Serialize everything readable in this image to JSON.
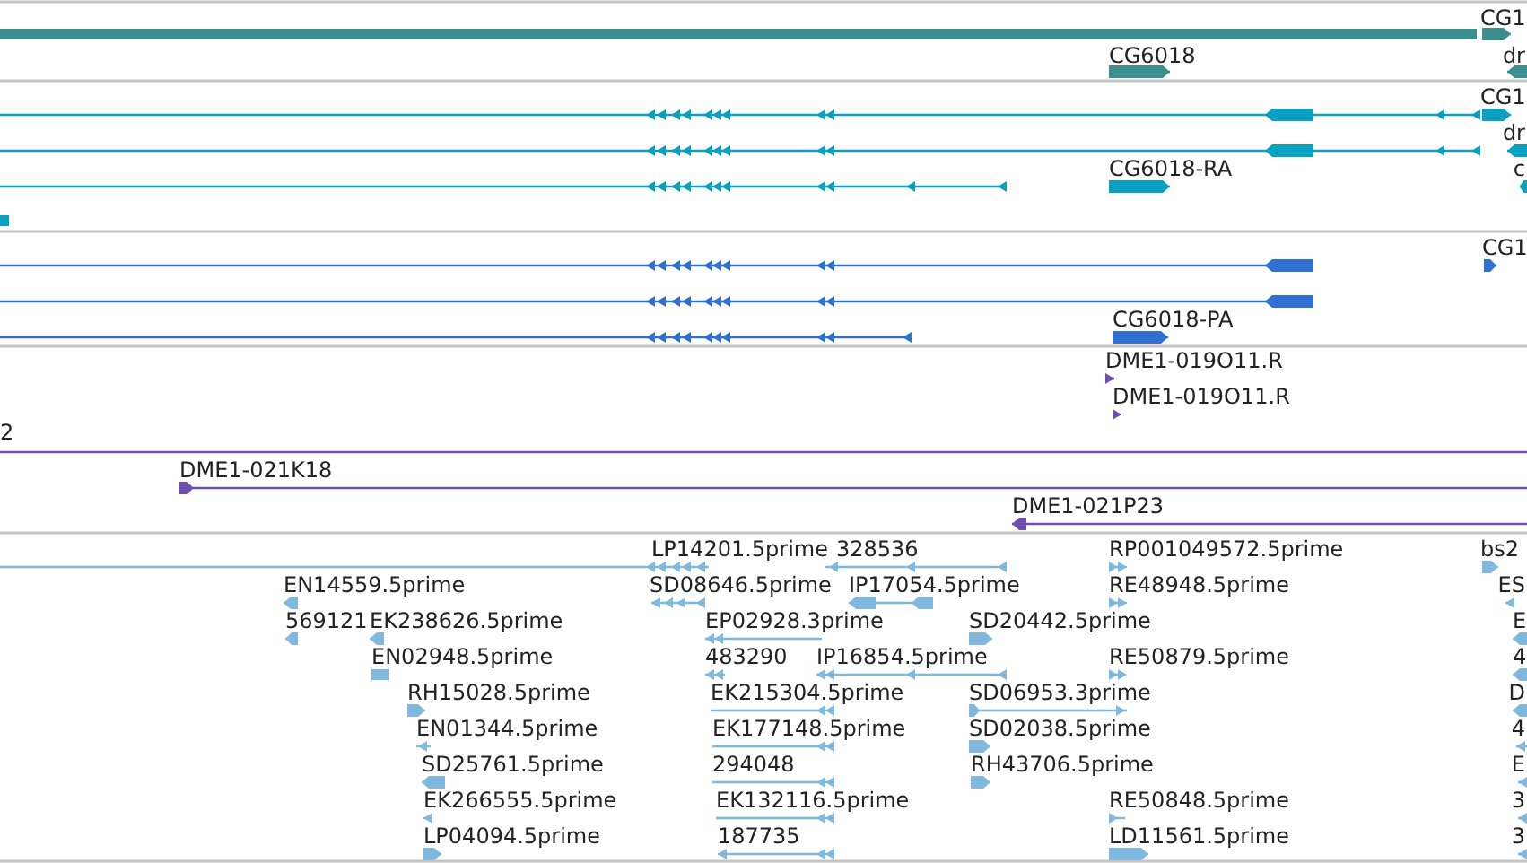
{
  "tracks": [
    {
      "color": "#3d8f8f",
      "features": [
        {
          "label": "CG1"
        },
        {
          "label": "CG6018"
        },
        {
          "label": "dr"
        }
      ]
    },
    {
      "color": "#0aa0c0",
      "features": [
        {
          "label": "CG1"
        },
        {
          "label": "dr"
        },
        {
          "label": "CG6018-RA"
        },
        {
          "label": "c"
        }
      ]
    },
    {
      "color": "#3070d0",
      "features": [
        {
          "label": "CG1"
        },
        {
          "label": "CG6018-PA"
        }
      ]
    },
    {
      "color": "#6e4fae",
      "features": [
        {
          "label": "DME1-019O11.R"
        },
        {
          "label": "DME1-019O11.R"
        },
        {
          "label": "2"
        },
        {
          "label": "DME1-021K18"
        },
        {
          "label": "DME1-021P23"
        }
      ]
    },
    {
      "color": "#80b8e0",
      "features": [
        {
          "label": "LP14201.5prime"
        },
        {
          "label": "328536"
        },
        {
          "label": "RP001049572.5prime"
        },
        {
          "label": "bs2"
        },
        {
          "label": "EN14559.5prime"
        },
        {
          "label": "SD08646.5prime"
        },
        {
          "label": "IP17054.5prime"
        },
        {
          "label": "RE48948.5prime"
        },
        {
          "label": "ES"
        },
        {
          "label": "569121"
        },
        {
          "label": "EK238626.5prime"
        },
        {
          "label": "EP02928.3prime"
        },
        {
          "label": "SD20442.5prime"
        },
        {
          "label": "E"
        },
        {
          "label": "EN02948.5prime"
        },
        {
          "label": "483290"
        },
        {
          "label": "IP16854.5prime"
        },
        {
          "label": "RE50879.5prime"
        },
        {
          "label": "4"
        },
        {
          "label": "RH15028.5prime"
        },
        {
          "label": "EK215304.5prime"
        },
        {
          "label": "SD06953.3prime"
        },
        {
          "label": "D"
        },
        {
          "label": "EN01344.5prime"
        },
        {
          "label": "EK177148.5prime"
        },
        {
          "label": "SD02038.5prime"
        },
        {
          "label": "4"
        },
        {
          "label": "SD25761.5prime"
        },
        {
          "label": "294048"
        },
        {
          "label": "RH43706.5prime"
        },
        {
          "label": "E"
        },
        {
          "label": "EK266555.5prime"
        },
        {
          "label": "EK132116.5prime"
        },
        {
          "label": "RE50848.5prime"
        },
        {
          "label": "3"
        },
        {
          "label": "LP04094.5prime"
        },
        {
          "label": "187735"
        },
        {
          "label": "LD11561.5prime"
        },
        {
          "label": "3"
        }
      ]
    }
  ]
}
